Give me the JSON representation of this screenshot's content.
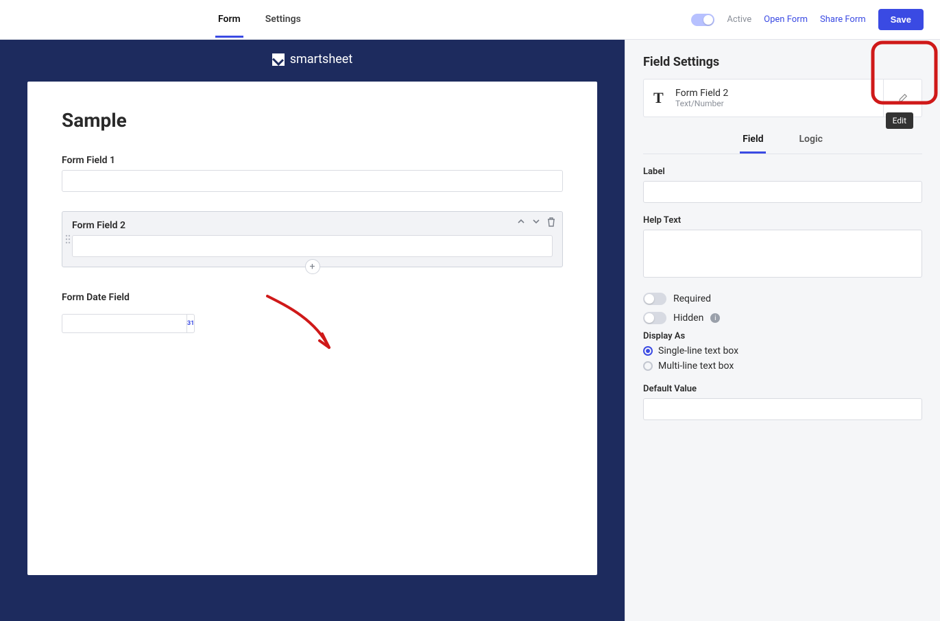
{
  "top": {
    "tabs": [
      "Form",
      "Settings"
    ],
    "active_tab": 0,
    "toggle_label": "Active",
    "open_form": "Open Form",
    "share_form": "Share Form",
    "save": "Save"
  },
  "brand": "smartsheet",
  "form": {
    "title": "Sample",
    "field1_label": "Form Field 1",
    "field2_label": "Form Field 2",
    "date_label": "Form Date Field",
    "calendar_day": "31"
  },
  "side": {
    "heading": "Field Settings",
    "selected": {
      "name": "Form Field 2",
      "type": "Text/Number",
      "glyph": "T"
    },
    "edit_tooltip": "Edit",
    "tabs": [
      "Field",
      "Logic"
    ],
    "active_tab": 0,
    "labels": {
      "label": "Label",
      "help": "Help Text",
      "required": "Required",
      "hidden": "Hidden",
      "display_as": "Display As",
      "single": "Single-line text box",
      "multi": "Multi-line text box",
      "default": "Default Value"
    },
    "values": {
      "label": "",
      "help": "",
      "required": false,
      "hidden": false,
      "display_as": "single",
      "default": ""
    }
  }
}
